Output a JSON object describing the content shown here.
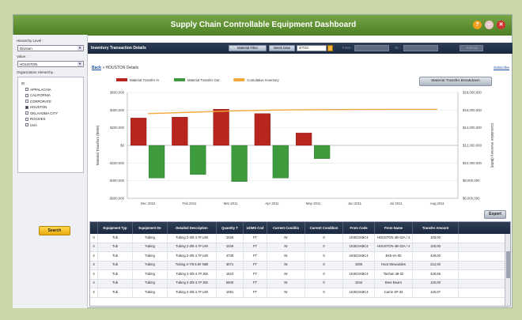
{
  "app": {
    "title": "Supply Chain Controllable Equipment Dashboard"
  },
  "window_buttons": {
    "help": "?",
    "min": "–",
    "close": "✕"
  },
  "colors": {
    "titlebar": "#5a8c2e",
    "toolbar": "#22324a",
    "transfer_in": "#b8241e",
    "transfer_out": "#3d9b3d",
    "cumulative": "#f2a93b"
  },
  "left": {
    "hierarchy_label": "Hierarchy Level :",
    "hierarchy_value": "Division",
    "value_label": "Value :",
    "value_value": "HOUSTON",
    "org_label": "Organization Hierarchy :",
    "tree": [
      "APPALACHIA",
      "CALIFORNIA",
      "CORPORATE",
      "HOUSTON",
      "OKLAHOMA CITY",
      "ROCKIES",
      "USA"
    ],
    "search_label": "Search"
  },
  "toolbar": {
    "title": "Inventory Transaction Details",
    "material_filter": "Material Filter",
    "week_date": "Week Date",
    "date_value": "4/7/10",
    "from_label": "From :",
    "to_label": "To :",
    "refresh": "Refresh"
  },
  "breadcrumb": {
    "back": "Back",
    "sep": "»",
    "current": "HOUSTON Details"
  },
  "subscribe": "Subscribe",
  "breakdown_button": "Material Transfer Breakdown",
  "export_button": "Export",
  "grid": {
    "columns": [
      "",
      "Equipment Typ",
      "Equipment De",
      "Detailed Description",
      "Quantity T",
      "UOMS Cod",
      "Current Conditio",
      "Current Condition",
      "From Code",
      "From Name",
      "Transfer Amount"
    ],
    "rows": [
      [
        "0",
        "Tub",
        "Tubing",
        "Tubing 2-3/8 4.7# L80",
        "1026",
        "FT",
        "NI",
        "0",
        "1KSD3ABC4",
        "HOUSTON 4B-32A / 4",
        "100,00"
      ],
      [
        "4",
        "Tub",
        "Tubing",
        "Tubing 2-3/8 4.7# L80",
        "1026",
        "FT",
        "NI",
        "0",
        "1KSD3ABC4",
        "HOUSTON 4B-32A / 4",
        "100,00"
      ],
      [
        "4",
        "Tub",
        "Tubing",
        "Tubing 2-3/8 4.7# L80",
        "4730",
        "FT",
        "NI",
        "0",
        "4KSD3ABC4",
        "B45-4A-00",
        "428,00"
      ],
      [
        "4",
        "Tub",
        "Tubing",
        "Tubing 2-7/8 6.5# N80",
        "3071",
        "FT",
        "NI",
        "0",
        "1000",
        "Hoot Stewarides",
        "212,00"
      ],
      [
        "4",
        "Tub",
        "Tubing",
        "Tubing 2-3/8 4.7# J55",
        "1623",
        "FT",
        "NI",
        "0",
        "1KSD3ABC4",
        "Tanhan 48-32",
        "428,65"
      ],
      [
        "4",
        "Tub",
        "Tubing",
        "Tubing 2-3/8 4.7# J55",
        "5940",
        "FT",
        "NI",
        "0",
        "1044",
        "Bree Bearn",
        "120,00"
      ],
      [
        "4",
        "Tub",
        "Tubing",
        "Tubing 2-3/8 4.7# L80",
        "1091",
        "FT",
        "NI",
        "0",
        "1KSD3ABC4",
        "Carrie 4P-33",
        "140,07"
      ]
    ]
  },
  "chart_data": {
    "type": "bar",
    "legend": [
      "Material Transfer In",
      "Material Transfer Out",
      "Cumulative Inventory"
    ],
    "legend_position": "top-left",
    "ylabel": "Material Transfers ($MM)",
    "y2label": "Cumulative Inventory ($MM)",
    "categories": [
      "Dec 2010",
      "Feb 2011",
      "Mar 2011",
      "Apr 2011",
      "May 2011",
      "Jun 2011",
      "Jul 2011",
      "Aug 2011"
    ],
    "y_ticks": [
      "$600,000",
      "$400,000",
      "$200,000",
      "$0",
      "-$200,000",
      "-$400,000",
      "-$600,000"
    ],
    "y2_ticks": [
      "$18,000,000",
      "$16,000,000",
      "$14,000,000",
      "$12,000,000",
      "$10,000,000",
      "$8,000,000",
      "$6,000,000"
    ],
    "ylim": [
      -600000,
      600000
    ],
    "y2lim": [
      6000000,
      18000000
    ],
    "series": [
      {
        "name": "Material Transfer In",
        "values": [
          310000,
          320000,
          410000,
          360000,
          140000,
          0,
          0,
          0
        ]
      },
      {
        "name": "Material Transfer Out",
        "values": [
          -370000,
          -330000,
          -410000,
          -370000,
          -150000,
          0,
          0,
          0
        ]
      },
      {
        "name": "Cumulative Inventory",
        "values": [
          15600000,
          15750000,
          15900000,
          16000000,
          16050000,
          16070000,
          16080000,
          16080000
        ]
      }
    ],
    "grid": true
  }
}
